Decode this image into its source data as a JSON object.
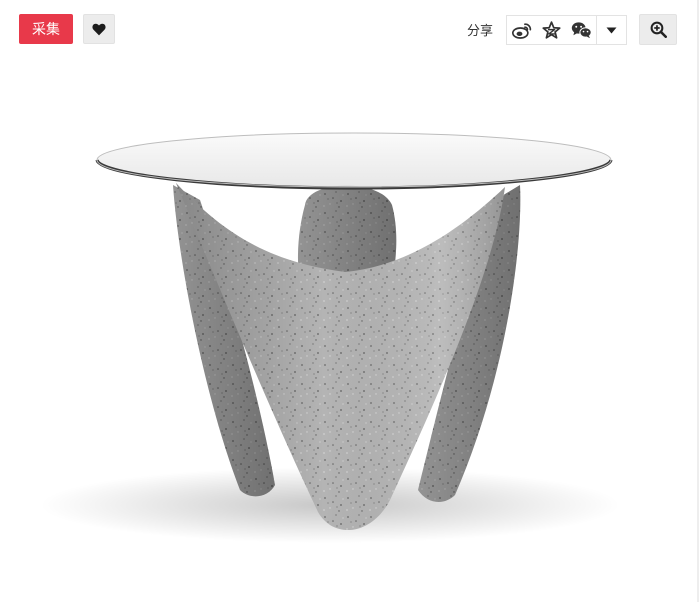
{
  "toolbar": {
    "collect_label": "采集",
    "like_icon": "heart-icon",
    "share_label": "分享",
    "share_icons": [
      "weibo-icon",
      "qzone-star-icon",
      "wechat-icon"
    ],
    "share_more_icon": "caret-down-icon",
    "zoom_icon": "zoom-in-icon"
  },
  "colors": {
    "collect_button": "#e8394a",
    "button_gray": "#ececec",
    "icon_dark": "#333333"
  },
  "image": {
    "subject": "product-photo"
  }
}
